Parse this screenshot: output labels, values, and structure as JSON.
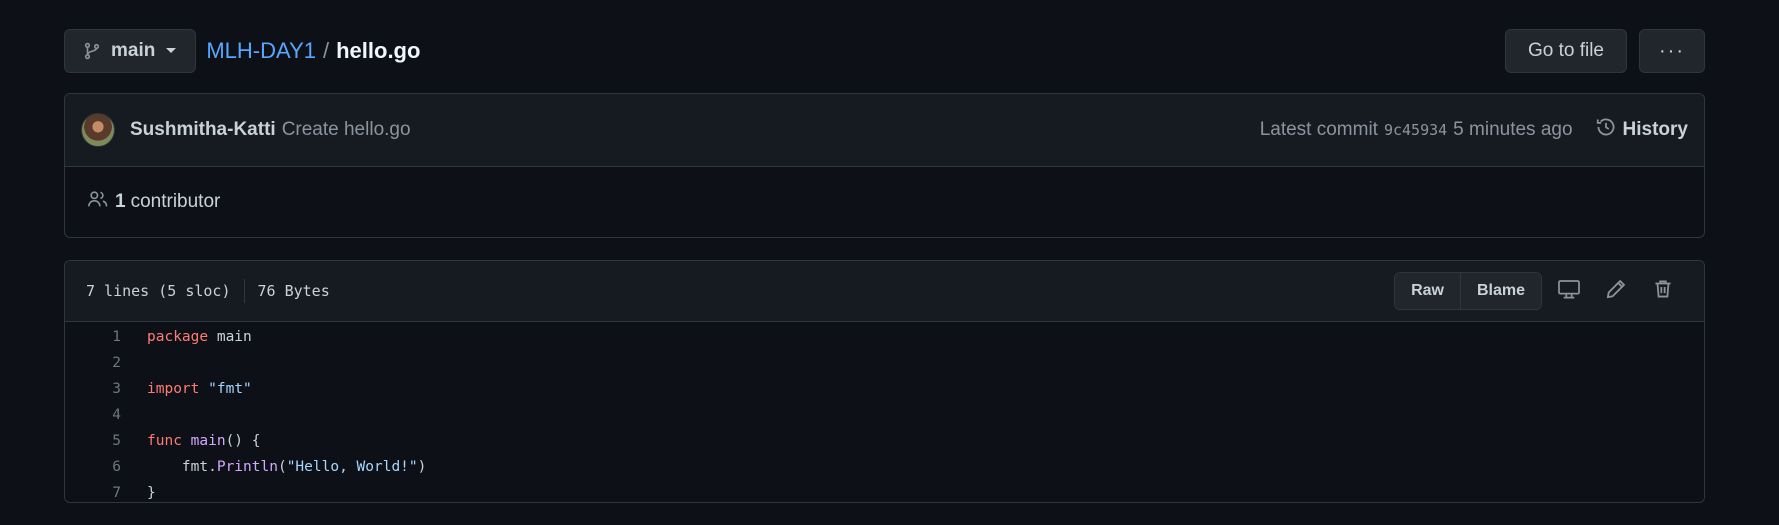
{
  "branch": {
    "label": "main"
  },
  "breadcrumb": {
    "repo": "MLH-DAY1",
    "separator": "/",
    "file": "hello.go"
  },
  "toolbar": {
    "go_to_file": "Go to file",
    "more": "···"
  },
  "commit": {
    "author": "Sushmitha-Katti",
    "message": "Create hello.go",
    "latest_label": "Latest commit",
    "sha": "9c45934",
    "time": "5 minutes ago",
    "history_label": "History"
  },
  "contributors": {
    "count": "1",
    "label": "contributor"
  },
  "file": {
    "lines_info": "7 lines (5 sloc)",
    "size": "76 Bytes",
    "raw_label": "Raw",
    "blame_label": "Blame"
  },
  "code": {
    "lines": [
      {
        "n": "1",
        "tokens": [
          {
            "t": "package",
            "c": "kw"
          },
          {
            "t": " main",
            "c": ""
          }
        ]
      },
      {
        "n": "2",
        "tokens": []
      },
      {
        "n": "3",
        "tokens": [
          {
            "t": "import",
            "c": "kw"
          },
          {
            "t": " ",
            "c": ""
          },
          {
            "t": "\"fmt\"",
            "c": "str"
          }
        ]
      },
      {
        "n": "4",
        "tokens": []
      },
      {
        "n": "5",
        "tokens": [
          {
            "t": "func",
            "c": "kw"
          },
          {
            "t": " ",
            "c": ""
          },
          {
            "t": "main",
            "c": "fn"
          },
          {
            "t": "() {",
            "c": ""
          }
        ]
      },
      {
        "n": "6",
        "tokens": [
          {
            "t": "    fmt.",
            "c": ""
          },
          {
            "t": "Println",
            "c": "fn"
          },
          {
            "t": "(",
            "c": ""
          },
          {
            "t": "\"Hello, World!\"",
            "c": "str"
          },
          {
            "t": ")",
            "c": ""
          }
        ]
      },
      {
        "n": "7",
        "tokens": [
          {
            "t": "}",
            "c": ""
          }
        ]
      }
    ]
  },
  "colors": {
    "background": "#0d1117",
    "link": "#58a6ff",
    "keyword": "#ff7b72",
    "string": "#a5d6ff",
    "function": "#d2a8ff"
  }
}
